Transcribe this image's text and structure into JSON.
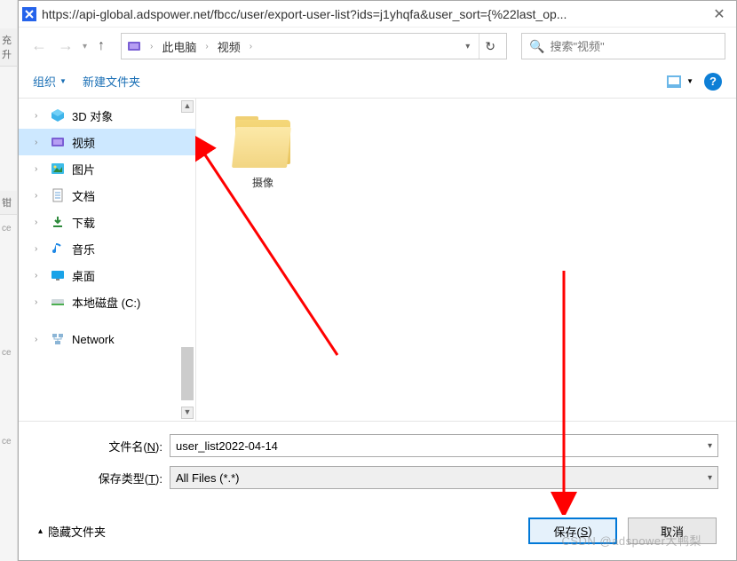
{
  "left_partial": {
    "top": "充升",
    "label": "钳",
    "ce1": "ce",
    "ce2": "ce",
    "ce3": "ce"
  },
  "titlebar": {
    "url": "https://api-global.adspower.net/fbcc/user/export-user-list?ids=j1yhqfa&user_sort={%22last_op..."
  },
  "breadcrumbs": {
    "pc": "此电脑",
    "videos": "视频"
  },
  "search": {
    "placeholder": "搜索\"视频\""
  },
  "toolbar": {
    "organize": "组织",
    "new_folder": "新建文件夹",
    "help": "?"
  },
  "sidebar": {
    "items": [
      {
        "label": "3D 对象",
        "icon": "3d"
      },
      {
        "label": "视频",
        "icon": "video",
        "selected": true
      },
      {
        "label": "图片",
        "icon": "picture"
      },
      {
        "label": "文档",
        "icon": "document"
      },
      {
        "label": "下载",
        "icon": "download"
      },
      {
        "label": "音乐",
        "icon": "music"
      },
      {
        "label": "桌面",
        "icon": "desktop"
      },
      {
        "label": "本地磁盘 (C:)",
        "icon": "disk"
      }
    ],
    "network": "Network"
  },
  "content": {
    "folder1": "摄像"
  },
  "fields": {
    "filename_label_pre": "文件名(",
    "filename_label_u": "N",
    "filename_label_post": "):",
    "filename_value": "user_list2022-04-14",
    "savetype_label_pre": "保存类型(",
    "savetype_label_u": "T",
    "savetype_label_post": "):",
    "savetype_value": "All Files (*.*)"
  },
  "footer": {
    "hide": "隐藏文件夹",
    "save_pre": "保存(",
    "save_u": "S",
    "save_post": ")",
    "cancel": "取消"
  },
  "watermark": "CSDN @adspower大鸭梨"
}
